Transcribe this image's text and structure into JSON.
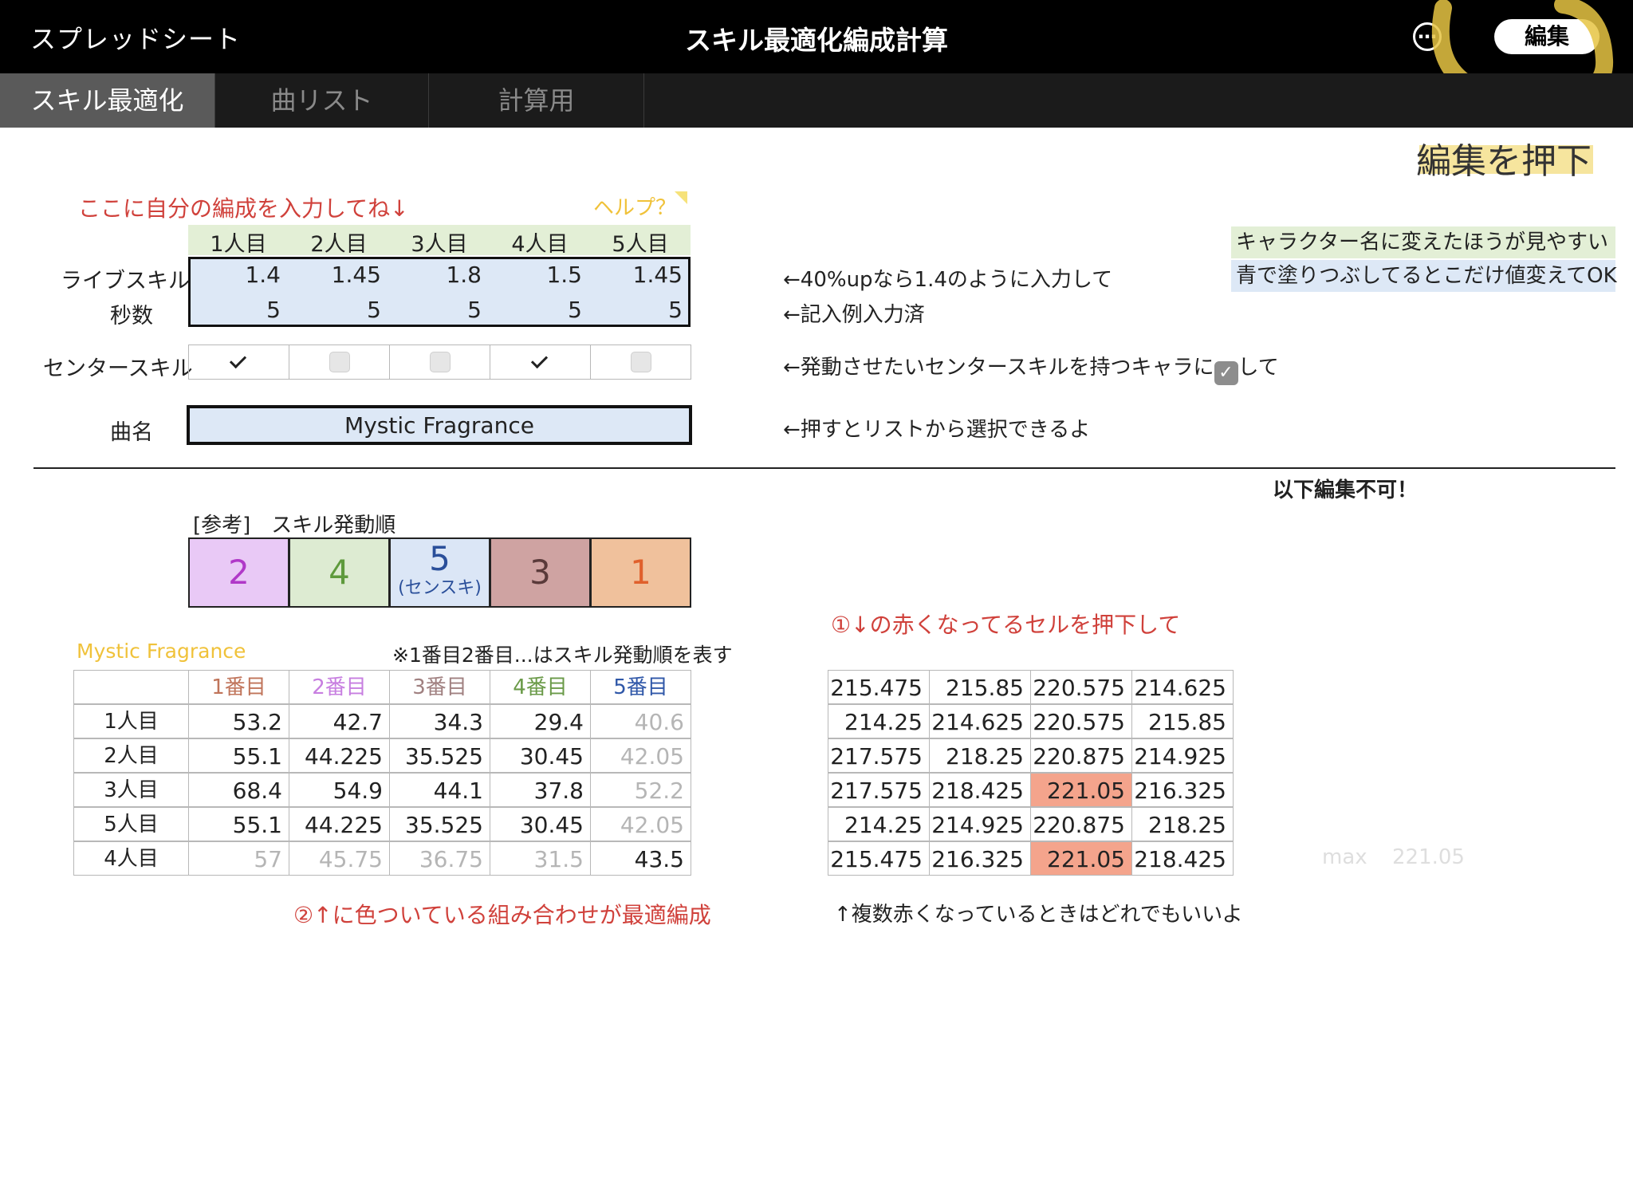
{
  "topbar": {
    "back_label": "スプレッドシート",
    "title": "スキル最適化編成計算",
    "more_icon": "more-icon",
    "edit_label": "編集"
  },
  "tabs": [
    {
      "label": "スキル最適化"
    },
    {
      "label": "曲リスト"
    },
    {
      "label": "計算用"
    }
  ],
  "annotation": {
    "press_edit": "編集を押下"
  },
  "input_section": {
    "prompt": "ここに自分の編成を入力してね↓",
    "help": "ヘルプ？",
    "members": [
      "1人目",
      "2人目",
      "3人目",
      "4人目",
      "5人目"
    ],
    "row_labels": {
      "live_skill": "ライブスキル",
      "seconds": "秒数",
      "center_skill": "センタースキル",
      "song": "曲名"
    },
    "live_skill": [
      "1.4",
      "1.45",
      "1.8",
      "1.5",
      "1.45"
    ],
    "seconds": [
      "5",
      "5",
      "5",
      "5",
      "5"
    ],
    "center_skill": [
      true,
      false,
      false,
      true,
      false
    ],
    "song_name": "Mystic Fragrance",
    "notes": {
      "live_skill": "←40%upなら1.4のように入力して",
      "seconds": "←記入例入力済",
      "center_skill_before": "←発動させたいセンタースキルを持つキャラに",
      "center_skill_after": "して",
      "song": "←押すとリストから選択できるよ"
    },
    "side_notes": {
      "green": "キャラクター名に変えたほうが見やすい",
      "blue": "青で塗りつぶしてるとこだけ値変えてOK"
    }
  },
  "readonly_note": "以下編集不可！",
  "order_section": {
    "label": "[参考]　スキル発動順",
    "cells": [
      {
        "value": "2",
        "sub": "",
        "color": "#e9c9f6",
        "text_color": "#b038c8"
      },
      {
        "value": "4",
        "sub": "",
        "color": "#ddebd2",
        "text_color": "#5e9a3c"
      },
      {
        "value": "5",
        "sub": "(センスキ)",
        "color": "#dbe6f6",
        "text_color": "#2a4f9a"
      },
      {
        "value": "3",
        "sub": "",
        "color": "#cfa3a2",
        "text_color": "#5a3a3a"
      },
      {
        "value": "1",
        "sub": "",
        "color": "#f0c19c",
        "text_color": "#e0602c"
      }
    ]
  },
  "score_section": {
    "song_label": "Mystic Fragrance",
    "order_note": "※1番目2番目...はスキル発動順を表す",
    "headers": [
      {
        "label": "1番目",
        "color": "#c0745a"
      },
      {
        "label": "2番目",
        "color": "#c77ee0"
      },
      {
        "label": "3番目",
        "color": "#a08080"
      },
      {
        "label": "4番目",
        "color": "#6a9a48"
      },
      {
        "label": "5番目",
        "color": "#2f57a8"
      }
    ],
    "rows": [
      {
        "label": "1人目",
        "values": [
          "53.2",
          "42.7",
          "34.3",
          "29.4",
          "40.6"
        ],
        "dim": [
          false,
          false,
          false,
          false,
          true
        ]
      },
      {
        "label": "2人目",
        "values": [
          "55.1",
          "44.225",
          "35.525",
          "30.45",
          "42.05"
        ],
        "dim": [
          false,
          false,
          false,
          false,
          true
        ]
      },
      {
        "label": "3人目",
        "values": [
          "68.4",
          "54.9",
          "44.1",
          "37.8",
          "52.2"
        ],
        "dim": [
          false,
          false,
          false,
          false,
          true
        ]
      },
      {
        "label": "5人目",
        "values": [
          "55.1",
          "44.225",
          "35.525",
          "30.45",
          "42.05"
        ],
        "dim": [
          false,
          false,
          false,
          false,
          true
        ]
      },
      {
        "label": "4人目",
        "values": [
          "57",
          "45.75",
          "36.75",
          "31.5",
          "43.5"
        ],
        "dim": [
          true,
          true,
          true,
          true,
          false
        ]
      }
    ],
    "bottom_note": "②↑に色ついている組み合わせが最適編成"
  },
  "totals_section": {
    "note": "①↓の赤くなってるセルを押下して",
    "rows": [
      [
        "215.475",
        "215.85",
        "220.575",
        "214.625"
      ],
      [
        "214.25",
        "214.625",
        "220.575",
        "215.85"
      ],
      [
        "217.575",
        "218.25",
        "220.875",
        "214.925"
      ],
      [
        "217.575",
        "218.425",
        "221.05",
        "216.325"
      ],
      [
        "214.25",
        "214.925",
        "220.875",
        "218.25"
      ],
      [
        "215.475",
        "216.325",
        "221.05",
        "218.425"
      ]
    ],
    "highlight": [
      [
        3,
        2
      ],
      [
        5,
        2
      ]
    ],
    "highlight_color": "#f4a48c",
    "bottom_note": "↑複数赤くなっているときはどれでもいいよ",
    "max_label": "max",
    "max_value": "221.05"
  }
}
